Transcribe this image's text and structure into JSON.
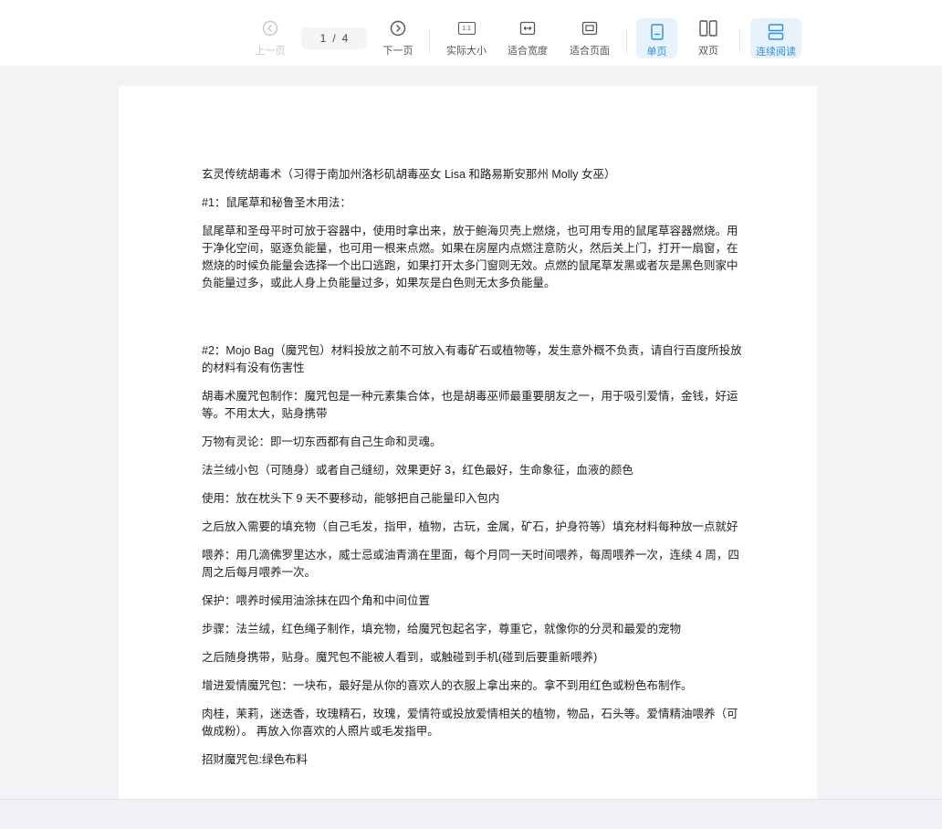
{
  "toolbar": {
    "prev": "上一页",
    "page_current": "1",
    "page_sep": "/",
    "page_total": "4",
    "next": "下一页",
    "actual_size": "实际大小",
    "actual_size_icon_text": "1:1",
    "fit_width": "适合宽度",
    "fit_page": "适合页面",
    "single_page": "单页",
    "double_page": "双页",
    "continuous": "连续阅读"
  },
  "document": {
    "paragraphs": [
      "玄灵传统胡毒术（习得于南加州洛杉矶胡毒巫女 Lisa 和路易斯安那州 Molly 女巫）",
      "#1：鼠尾草和秘鲁圣木用法：",
      "鼠尾草和圣母平时可放于容器中，使用时拿出来，放于鲍海贝壳上燃烧，也可用专用的鼠尾草容器燃烧。用于净化空间，驱逐负能量，也可用一根来点燃。如果在房屋内点燃注意防火，然后关上门，打开一扇窗，在燃烧的时候负能量会选择一个出口逃跑，如果打开太多门窗则无效。点燃的鼠尾草发黑或者灰是黑色则家中负能量过多，或此人身上负能量过多，如果灰是白色则无太多负能量。",
      "#2：Mojo Bag（魔咒包）材料投放之前不可放入有毒矿石或植物等，发生意外概不负责，请自行百度所投放的材料有没有伤害性",
      "胡毒术魔咒包制作：魔咒包是一种元素集合体，也是胡毒巫师最重要朋友之一，用于吸引爱情，金钱，好运等。不用太大，贴身携带",
      "万物有灵论：即一切东西都有自己生命和灵魂。",
      "法兰绒小包（可随身）或者自己缝纫，效果更好 3，红色最好，生命象征，血液的颜色",
      "使用：放在枕头下 9 天不要移动，能够把自己能量印入包内",
      "之后放入需要的填充物（自己毛发，指甲，植物，古玩，金属，矿石，护身符等）填充材料每种放一点就好",
      "喂养：用几滴佛罗里达水，威士忌或油青滴在里面，每个月同一天时间喂养，每周喂养一次，连续 4 周，四周之后每月喂养一次。",
      "保护：喂养时候用油涂抹在四个角和中间位置",
      "步骤：法兰绒，红色绳子制作，填充物，给魔咒包起名字，尊重它，就像你的分灵和最爱的宠物",
      "之后随身携带，贴身。魔咒包不能被人看到，或触碰到手机(碰到后要重新喂养)",
      "增进爱情魔咒包：一块布，最好是从你的喜欢人的衣服上拿出来的。拿不到用红色或粉色布制作。",
      "肉桂，茉莉，迷迭香，玫瑰精石，玫瑰，爱情符或投放爱情相关的植物，物品，石头等。爱情精油喂养（可做成粉）。 再放入你喜欢的人照片或毛发指甲。",
      "招财魔咒包:绿色布料"
    ]
  },
  "colors": {
    "accent": "#2b8fe0",
    "active_bg": "#e7f2fb",
    "page_bg": "#f2f3f5",
    "disabled": "#c4c7cc"
  }
}
